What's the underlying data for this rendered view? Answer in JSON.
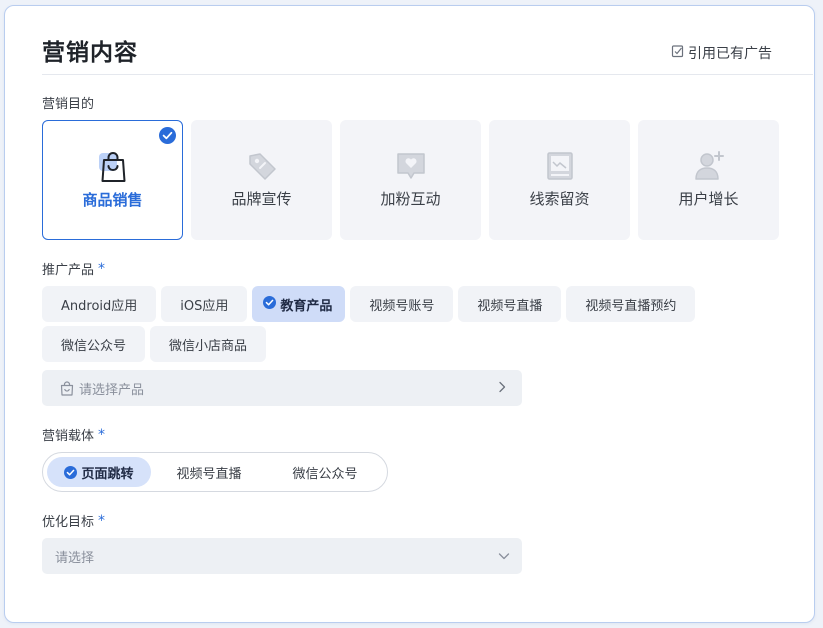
{
  "title": "营销内容",
  "ref_ad": "引用已有广告",
  "goal": {
    "label": "营销目的",
    "items": [
      {
        "label": "商品销售",
        "icon": "shopping-bag-icon",
        "selected": true
      },
      {
        "label": "品牌宣传",
        "icon": "tag-icon",
        "selected": false
      },
      {
        "label": "加粉互动",
        "icon": "heart-chat-icon",
        "selected": false
      },
      {
        "label": "线索留资",
        "icon": "image-form-icon",
        "selected": false
      },
      {
        "label": "用户增长",
        "icon": "add-user-icon",
        "selected": false
      }
    ]
  },
  "product": {
    "label": "推广产品",
    "required_mark": "*",
    "options": [
      "Android应用",
      "iOS应用",
      "教育产品",
      "视频号账号",
      "视频号直播",
      "视频号直播预约",
      "微信公众号",
      "微信小店商品"
    ],
    "selected": "教育产品",
    "select_placeholder": "请选择产品"
  },
  "carrier": {
    "label": "营销载体",
    "required_mark": "*",
    "options": [
      "页面跳转",
      "视频号直播",
      "微信公众号"
    ],
    "selected": "页面跳转"
  },
  "optimize": {
    "label": "优化目标",
    "required_mark": "*",
    "placeholder": "请选择"
  },
  "colors": {
    "accent": "#2a6cd9",
    "chip_bg": "#f1f3f7",
    "chip_active_bg": "#cfdcf8"
  }
}
